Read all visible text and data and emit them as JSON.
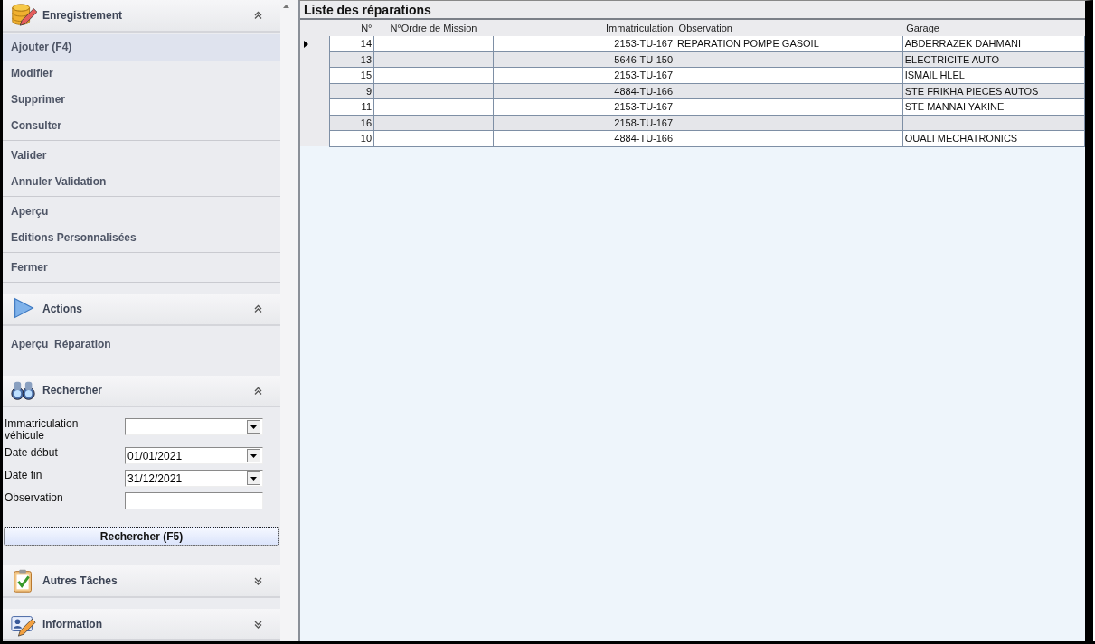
{
  "sidebar": {
    "sections": [
      {
        "title": "Enregistrement",
        "expanded": true,
        "groups": [
          [
            {
              "label": "Ajouter (F4)",
              "selected": true
            },
            {
              "label": "Modifier",
              "selected": false
            },
            {
              "label": "Supprimer",
              "selected": false
            },
            {
              "label": "Consulter",
              "selected": false
            }
          ],
          [
            {
              "label": "Valider",
              "selected": false
            },
            {
              "label": "Annuler Validation",
              "selected": false
            }
          ],
          [
            {
              "label": "Aperçu",
              "selected": false
            },
            {
              "label": "Editions Personnalisées",
              "selected": false
            }
          ],
          [
            {
              "label": "Fermer",
              "selected": false
            }
          ]
        ]
      },
      {
        "title": "Actions",
        "expanded": true,
        "groups": [
          [
            {
              "label": "Aperçu  Réparation",
              "selected": false
            }
          ]
        ]
      },
      {
        "title": "Rechercher",
        "expanded": true,
        "form": {
          "fields": [
            {
              "label": "Immatriculation véhicule",
              "kind": "combo"
            },
            {
              "label": "Date début",
              "kind": "combo",
              "value": "01/01/2021"
            },
            {
              "label": "Date fin",
              "kind": "combo",
              "value": "31/12/2021"
            },
            {
              "label": "Observation",
              "kind": "text"
            }
          ],
          "button": "Rechercher (F5)"
        }
      },
      {
        "title": "Autres Tâches",
        "expanded": false
      },
      {
        "title": "Information",
        "expanded": false
      }
    ]
  },
  "table": {
    "title": "Liste des réparations",
    "columns": [
      "N°",
      "N°Ordre de Mission",
      "Immatriculation",
      "Observation",
      "Garage"
    ],
    "rows": [
      {
        "selected": true,
        "cells": [
          "14",
          "",
          "2153-TU-167",
          "REPARATION POMPE GASOIL",
          "ABDERRAZEK DAHMANI"
        ]
      },
      {
        "selected": false,
        "cells": [
          "13",
          "",
          "5646-TU-150",
          "",
          "ELECTRICITE AUTO"
        ]
      },
      {
        "selected": false,
        "cells": [
          "15",
          "",
          "2153-TU-167",
          "",
          "ISMAIL HLEL"
        ]
      },
      {
        "selected": false,
        "cells": [
          "9",
          "",
          "4884-TU-166",
          "",
          "STE FRIKHA PIECES AUTOS"
        ]
      },
      {
        "selected": false,
        "cells": [
          "11",
          "",
          "2153-TU-167",
          "",
          "STE MANNAI YAKINE"
        ]
      },
      {
        "selected": false,
        "cells": [
          "16",
          "",
          "2158-TU-167",
          "",
          ""
        ]
      },
      {
        "selected": false,
        "cells": [
          "10",
          "",
          "4884-TU-166",
          "",
          "OUALI MECHATRONICS"
        ]
      }
    ]
  }
}
